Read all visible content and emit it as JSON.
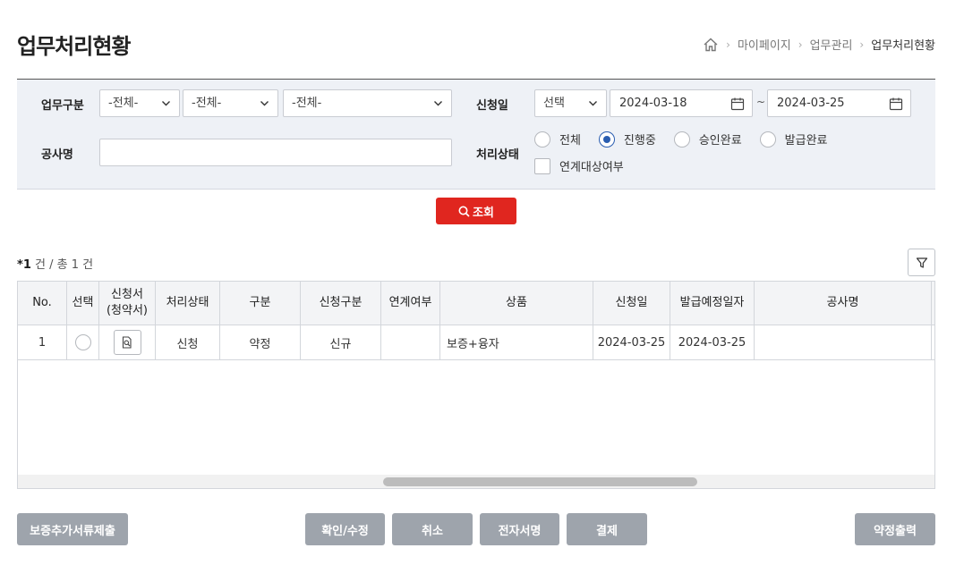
{
  "page": {
    "title": "업무처리현황"
  },
  "breadcrumb": {
    "items": [
      "마이페이지",
      "업무관리",
      "업무처리현황"
    ]
  },
  "search": {
    "task_type_label": "업무구분",
    "task_type_1": "-전체-",
    "task_type_2": "-전체-",
    "task_type_3": "-전체-",
    "apply_date_label": "신청일",
    "date_mode": "선택",
    "date_from": "2024-03-18",
    "date_sep": "~",
    "date_to": "2024-03-25",
    "project_label": "공사명",
    "project_value": "",
    "status_label": "처리상태",
    "status_options": [
      {
        "label": "전체",
        "selected": false
      },
      {
        "label": "진행중",
        "selected": true
      },
      {
        "label": "승인완료",
        "selected": false
      },
      {
        "label": "발급완료",
        "selected": false
      }
    ],
    "link_check_label": "연계대상여부",
    "search_button": "조회"
  },
  "results": {
    "count_prefix": "*",
    "count_current": "1",
    "count_text": " 건 / 총 1 건"
  },
  "table": {
    "headers": [
      "No.",
      "선택",
      "신청서\n(청약서)",
      "처리상태",
      "구분",
      "신청구분",
      "연계여부",
      "상품",
      "신청일",
      "발급예정일자",
      "공사명"
    ],
    "rows": [
      {
        "no": "1",
        "status": "신청",
        "type": "약정",
        "apply_type": "신규",
        "linked": "",
        "product": "보증+융자",
        "apply_date": "2024-03-25",
        "issue_date": "2024-03-25",
        "project": ""
      }
    ]
  },
  "buttons": {
    "extra_docs": "보증추가서류제출",
    "confirm_edit": "확인/수정",
    "cancel": "취소",
    "e_sign": "전자서명",
    "payment": "결제",
    "print_agreement": "약정출력"
  },
  "colors": {
    "primary_red": "#e0261f",
    "selected_radio": "#2a5db0",
    "gray_button": "#9ea4ac",
    "search_bg": "#eef1f6"
  }
}
